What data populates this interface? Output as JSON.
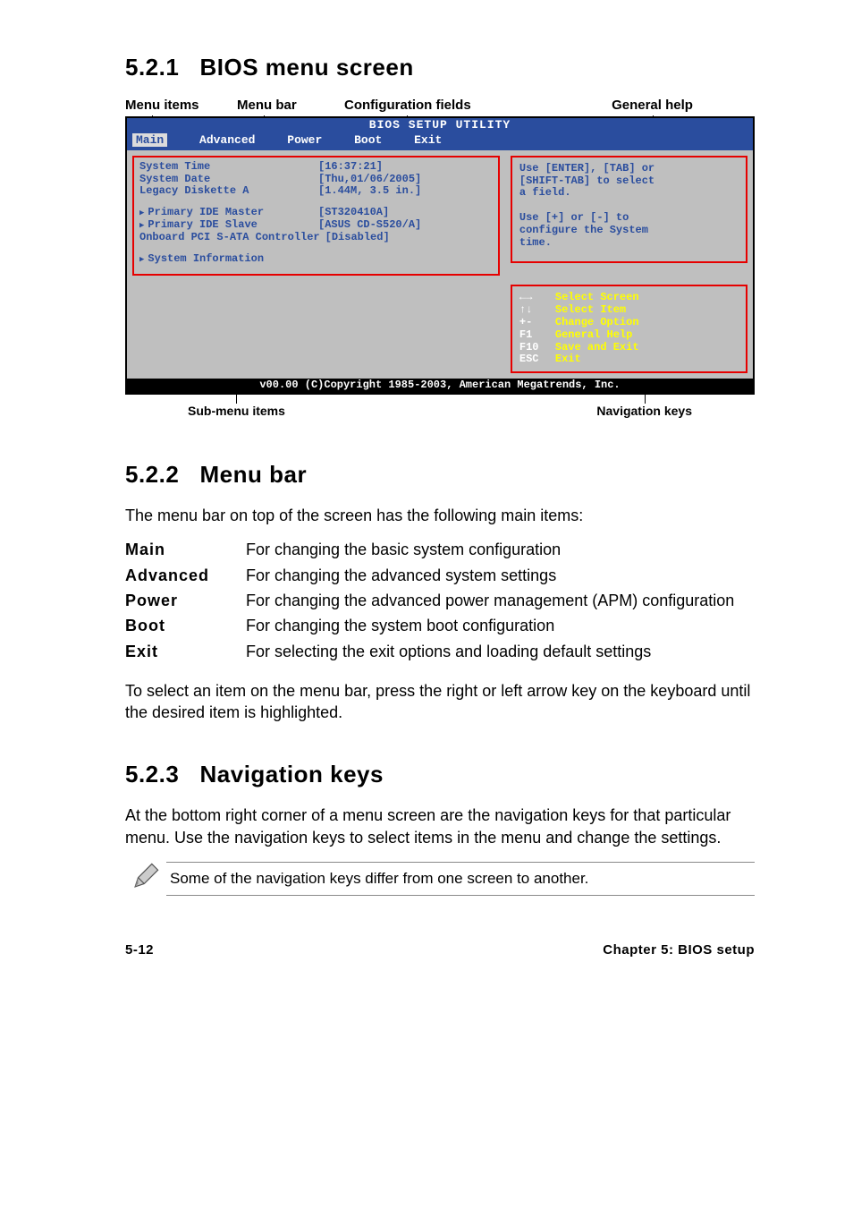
{
  "sec1": {
    "num": "5.2.1",
    "title": "BIOS menu screen",
    "ann_top": {
      "a": "Menu items",
      "b": "Menu bar",
      "c": "Configuration fields",
      "d": "General help"
    },
    "ann_bottom": {
      "left": "Sub-menu items",
      "right": "Navigation keys"
    }
  },
  "bios": {
    "title": "BIOS SETUP UTILITY",
    "menubar": [
      "Main",
      "Advanced",
      "Power",
      "Boot",
      "Exit"
    ],
    "selected_tab": "Main",
    "left_rows": [
      {
        "label": "System Time",
        "value": "[16:37:21]"
      },
      {
        "label": "System Date",
        "value": "[Thu,01/06/2005]"
      },
      {
        "label": "Legacy Diskette A",
        "value": "[1.44M, 3.5 in.]"
      }
    ],
    "left_submenu": [
      {
        "label": "Primary IDE Master",
        "value": "[ST320410A]"
      },
      {
        "label": "Primary IDE Slave",
        "value": "[ASUS CD-S520/A]"
      },
      {
        "label": "Onboard PCI S-ATA Controller",
        "value": "[Disabled]"
      }
    ],
    "left_last": "System Information",
    "help": [
      "Use [ENTER], [TAB] or",
      "[SHIFT-TAB] to select",
      "a field.",
      "",
      "Use [+] or [-] to",
      "configure the System",
      "time."
    ],
    "keys": [
      {
        "k": "←→",
        "d": "Select Screen"
      },
      {
        "k": "↑↓",
        "d": "Select Item"
      },
      {
        "k": "+-",
        "d": "Change Option"
      },
      {
        "k": "F1",
        "d": "General Help"
      },
      {
        "k": "F10",
        "d": "Save and Exit"
      },
      {
        "k": "ESC",
        "d": "Exit"
      }
    ],
    "footer": "v00.00 (C)Copyright 1985-2003, American Megatrends, Inc."
  },
  "sec2": {
    "num": "5.2.2",
    "title": "Menu bar",
    "intro": "The menu bar on top of the screen has the following main items:",
    "items": [
      {
        "label": "Main",
        "desc": "For changing the basic system configuration"
      },
      {
        "label": "Advanced",
        "desc": "For changing the advanced system settings"
      },
      {
        "label": "Power",
        "desc": "For changing the advanced power management (APM) configuration"
      },
      {
        "label": "Boot",
        "desc": "For changing the system boot configuration"
      },
      {
        "label": "Exit",
        "desc": "For selecting the exit options and loading default settings"
      }
    ],
    "outro": "To select an item on the menu bar, press the right or left arrow key on the keyboard until the desired item is highlighted."
  },
  "sec3": {
    "num": "5.2.3",
    "title": "Navigation keys",
    "para": "At the bottom right corner of a menu screen are the navigation keys for that particular menu. Use the navigation keys to select items in the menu and change the settings.",
    "note": "Some of the navigation keys differ from one screen to another."
  },
  "footer": {
    "left": "5-12",
    "right": "Chapter 5: BIOS setup"
  }
}
